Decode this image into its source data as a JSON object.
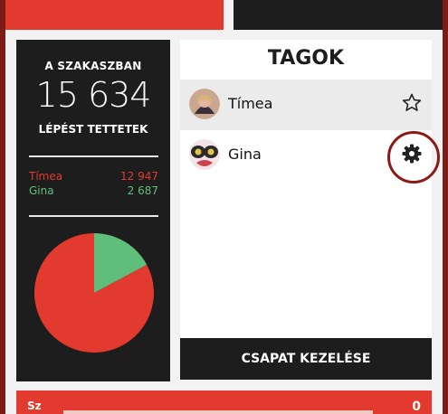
{
  "stats": {
    "heading": "A SZAKASZBAN",
    "total": "15 634",
    "subheading": "LÉPÉST TETTETEK",
    "rows": [
      {
        "name": "Tímea",
        "value": "12 947",
        "color": "#e23a2e"
      },
      {
        "name": "Gina",
        "value": "2 687",
        "color": "#5fbf7a"
      }
    ]
  },
  "members": {
    "title": "TAGOK",
    "items": [
      {
        "name": "Tímea",
        "icon": "star-outline-icon",
        "selected": true
      },
      {
        "name": "Gina",
        "icon": "gear-icon",
        "selected": false
      }
    ]
  },
  "actions": {
    "manage_label": "CSAPAT KEZELÉSE"
  },
  "bottom": {
    "label": "Sz",
    "value": "0"
  },
  "chart_data": {
    "type": "pie",
    "labels": [
      "Tímea",
      "Gina"
    ],
    "values": [
      12947,
      2687
    ],
    "colors": [
      "#e23a2e",
      "#5fbf7a"
    ]
  }
}
